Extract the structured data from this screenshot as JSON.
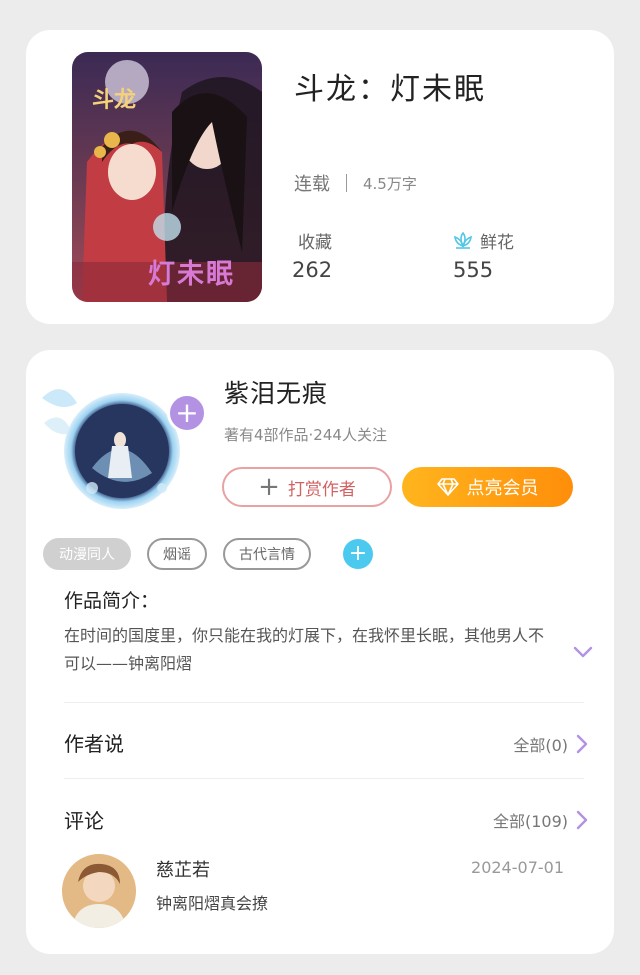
{
  "book": {
    "title": "斗龙：灯未眠",
    "status": "连载",
    "word_count": "4.5万字",
    "favorites_label": "收藏",
    "favorites_value": "262",
    "flowers_label": "鲜花",
    "flowers_value": "555",
    "cover_text_top": "斗龙",
    "cover_text_bottom": "灯未眠"
  },
  "author": {
    "name": "紫泪无痕",
    "stats": "著有4部作品·244人关注",
    "reward_button": "打赏作者",
    "vip_button": "点亮会员"
  },
  "tags": [
    "动漫同人",
    "烟谣",
    "古代言情"
  ],
  "intro": {
    "title": "作品简介：",
    "text": "在时间的国度里，你只能在我的灯展下，在我怀里长眠，其他男人不可以——钟离阳熠"
  },
  "author_says": {
    "title": "作者说",
    "link": "全部(0)"
  },
  "comments": {
    "title": "评论",
    "link": "全部(109)",
    "items": [
      {
        "user": "慈芷若",
        "date": "2024-07-01",
        "text": "钟离阳熠真会撩"
      }
    ]
  },
  "colors": {
    "accent_purple": "#b391e3",
    "vip_orange": "#ff9a12",
    "tag_add_blue": "#4cc9ee",
    "flower_blue": "#52c6e6"
  },
  "icons": {
    "flower": "lotus-icon",
    "diamond": "diamond-icon",
    "plus": "plus-icon",
    "chevron_right": "chevron-right-icon",
    "chevron_down": "chevron-down-icon"
  }
}
